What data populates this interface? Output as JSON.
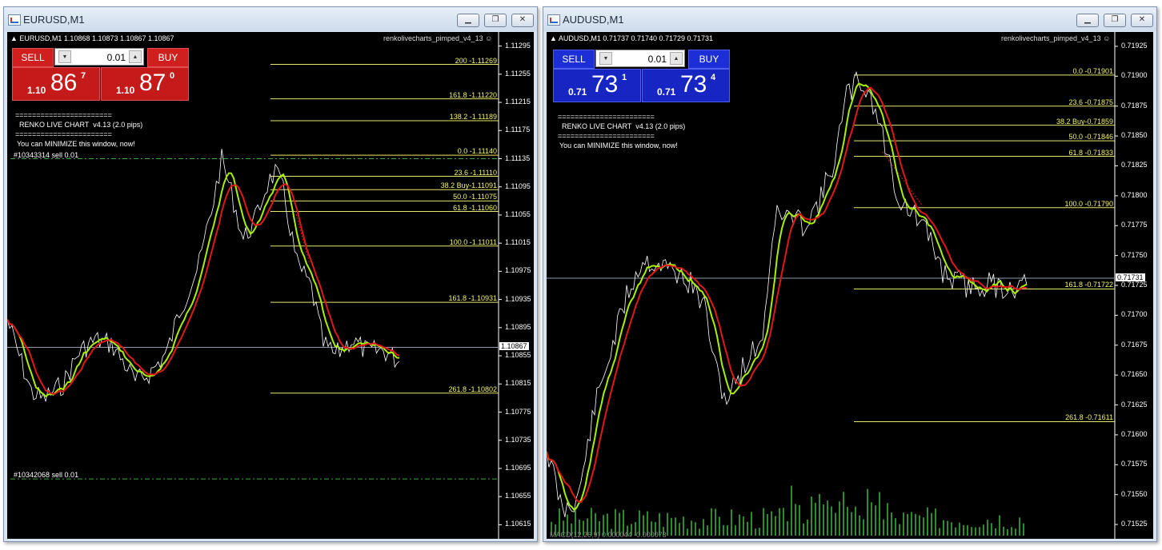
{
  "windows": [
    {
      "id": "left",
      "title": "EURUSD,M1",
      "symbol_line": "EURUSD,M1  1.10868 1.10873 1.10867 1.10867",
      "indicator_name": "renkolivecharts_pimped_v4_13",
      "indicator_icon": "smiley-icon",
      "panel": {
        "sell": "SELL",
        "buy": "BUY",
        "lot": "0.01",
        "bid_small": "1.10",
        "bid_big": "86",
        "bid_sup": "7",
        "ask_small": "1.10",
        "ask_big": "87",
        "ask_sup": "0",
        "color": "#cf1f1f"
      },
      "renko": [
        "=======================",
        "RENKO LIVE CHART  v4.13 (2.0 pips)",
        "=======================",
        "You can MINIMIZE this window, now!"
      ],
      "orders": [
        "#10343314 sell 0.01",
        "#10342068 sell 0.01"
      ],
      "fib_levels": [
        {
          "label": "200 -1.11269",
          "price": 1.11269
        },
        {
          "label": "161.8 -1.11220",
          "price": 1.1122
        },
        {
          "label": "138.2 -1.11189",
          "price": 1.11189
        },
        {
          "label": "0.0  -1.11140",
          "price": 1.1114
        },
        {
          "label": "23.6  -1.11110",
          "price": 1.1111
        },
        {
          "label": "38.2  Buy-1.11091",
          "price": 1.11091
        },
        {
          "label": "50.0  -1.11075",
          "price": 1.11075
        },
        {
          "label": "61.8  -1.11060",
          "price": 1.1106
        },
        {
          "label": "100.0  -1.11011",
          "price": 1.11011
        },
        {
          "label": "161.8  -1.10931",
          "price": 1.10931
        },
        {
          "label": "261.8  -1.10802",
          "price": 1.10802
        }
      ],
      "axis_ticks": [
        "1.11295",
        "1.11255",
        "1.11215",
        "1.11175",
        "1.11135",
        "1.11095",
        "1.11055",
        "1.11015",
        "1.10975",
        "1.10935",
        "1.10895",
        "1.10855",
        "1.10815",
        "1.10775",
        "1.10735",
        "1.10695",
        "1.10655",
        "1.10615"
      ],
      "current_price": "1.10867"
    },
    {
      "id": "right",
      "title": "AUDUSD,M1",
      "symbol_line": "AUDUSD,M1  0.71737 0.71740 0.71729 0.71731",
      "indicator_name": "renkolivecharts_pimped_v4_13",
      "indicator_icon": "smiley-icon",
      "panel": {
        "sell": "SELL",
        "buy": "BUY",
        "lot": "0.01",
        "bid_small": "0.71",
        "bid_big": "73",
        "bid_sup": "1",
        "ask_small": "0.71",
        "ask_big": "73",
        "ask_sup": "4",
        "color": "#1c2fd6"
      },
      "renko": [
        "=======================",
        "RENKO LIVE CHART  v4.13 (2.0 pips)",
        "=======================",
        "You can MINIMIZE this window, now!"
      ],
      "orders": [],
      "fib_levels": [
        {
          "label": "0.0  -0.71901",
          "price": 0.71901
        },
        {
          "label": "23.6  -0.71875",
          "price": 0.71875
        },
        {
          "label": "38.2  Buy-0.71859",
          "price": 0.71859
        },
        {
          "label": "50.0  -0.71846",
          "price": 0.71846
        },
        {
          "label": "61.8  -0.71833",
          "price": 0.71833
        },
        {
          "label": "100.0  -0.71790",
          "price": 0.7179
        },
        {
          "label": "161.8  -0.71722",
          "price": 0.71722
        },
        {
          "label": "261.8  -0.71611",
          "price": 0.71611
        }
      ],
      "axis_ticks": [
        "0.71925",
        "0.71900",
        "0.71875",
        "0.71850",
        "0.71825",
        "0.71800",
        "0.71775",
        "0.71750",
        "0.71725",
        "0.71700",
        "0.71675",
        "0.71650",
        "0.71625",
        "0.71600",
        "0.71575",
        "0.71550",
        "0.71525"
      ],
      "current_price": "0.71731",
      "bottom_label": "MACD(12,26,9) 0.000044 -0.000073"
    }
  ],
  "window_buttons": {
    "minimize": "▁",
    "restore": "❐",
    "close": "✕"
  }
}
